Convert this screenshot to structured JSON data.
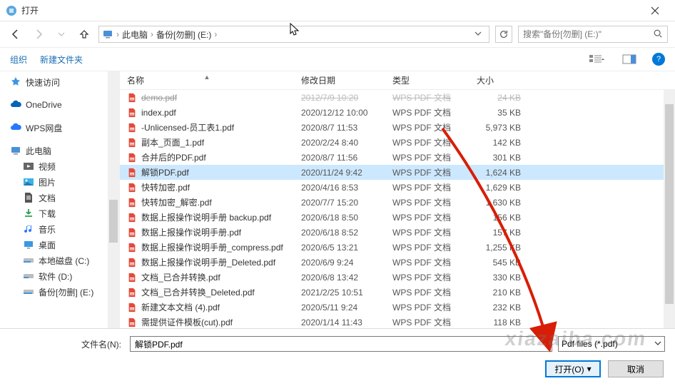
{
  "window": {
    "title": "打开"
  },
  "breadcrumb": {
    "root": "此电脑",
    "drive": "备份[勿删] (E:)"
  },
  "search": {
    "placeholder": "搜索\"备份[勿删] (E:)\""
  },
  "toolbar": {
    "organize": "组织",
    "newfolder": "新建文件夹"
  },
  "sidebar": {
    "quick": "快速访问",
    "onedrive": "OneDrive",
    "wps": "WPS网盘",
    "thispc": "此电脑",
    "video": "视频",
    "pictures": "图片",
    "documents": "文档",
    "downloads": "下载",
    "music": "音乐",
    "desktop": "桌面",
    "diskC": "本地磁盘 (C:)",
    "diskD": "软件 (D:)",
    "diskE": "备份[勿删] (E:)"
  },
  "columns": {
    "name": "名称",
    "date": "修改日期",
    "type": "类型",
    "size": "大小"
  },
  "files": [
    {
      "name": "demo.pdf",
      "date": "2012/7/9 10:20",
      "type": "WPS PDF 文档",
      "size": "24 KB",
      "cut": true
    },
    {
      "name": "index.pdf",
      "date": "2020/12/12 10:00",
      "type": "WPS PDF 文档",
      "size": "35 KB"
    },
    {
      "name": "-Unlicensed-员工表1.pdf",
      "date": "2020/8/7 11:53",
      "type": "WPS PDF 文档",
      "size": "5,973 KB"
    },
    {
      "name": "副本_页面_1.pdf",
      "date": "2020/2/24 8:40",
      "type": "WPS PDF 文档",
      "size": "142 KB"
    },
    {
      "name": "合并后的PDF.pdf",
      "date": "2020/8/7 11:56",
      "type": "WPS PDF 文档",
      "size": "301 KB"
    },
    {
      "name": "解锁PDF.pdf",
      "date": "2020/11/24 9:42",
      "type": "WPS PDF 文档",
      "size": "1,624 KB",
      "selected": true
    },
    {
      "name": "快转加密.pdf",
      "date": "2020/4/16 8:53",
      "type": "WPS PDF 文档",
      "size": "1,629 KB"
    },
    {
      "name": "快转加密_解密.pdf",
      "date": "2020/7/7 15:20",
      "type": "WPS PDF 文档",
      "size": "1,630 KB"
    },
    {
      "name": "数据上报操作说明手册 backup.pdf",
      "date": "2020/6/18 8:50",
      "type": "WPS PDF 文档",
      "size": "156 KB"
    },
    {
      "name": "数据上报操作说明手册.pdf",
      "date": "2020/6/18 8:52",
      "type": "WPS PDF 文档",
      "size": "157 KB"
    },
    {
      "name": "数据上报操作说明手册_compress.pdf",
      "date": "2020/6/5 13:21",
      "type": "WPS PDF 文档",
      "size": "1,255 KB"
    },
    {
      "name": "数据上报操作说明手册_Deleted.pdf",
      "date": "2020/6/9 9:24",
      "type": "WPS PDF 文档",
      "size": "545 KB"
    },
    {
      "name": "文档_已合并转换.pdf",
      "date": "2020/6/8 13:42",
      "type": "WPS PDF 文档",
      "size": "330 KB"
    },
    {
      "name": "文档_已合并转换_Deleted.pdf",
      "date": "2021/2/25 10:51",
      "type": "WPS PDF 文档",
      "size": "210 KB"
    },
    {
      "name": "新建文本文档 (4).pdf",
      "date": "2020/5/11 9:24",
      "type": "WPS PDF 文档",
      "size": "232 KB"
    },
    {
      "name": "需提供证件模板(cut).pdf",
      "date": "2020/1/14 11:43",
      "type": "WPS PDF 文档",
      "size": "118 KB"
    }
  ],
  "footer": {
    "filename_label": "文件名(N):",
    "filename_value": "解锁PDF.pdf",
    "filter": "Pdf files (*.pdf)",
    "open": "打开(O)",
    "cancel": "取消"
  },
  "watermark": "xiazaiba.com"
}
